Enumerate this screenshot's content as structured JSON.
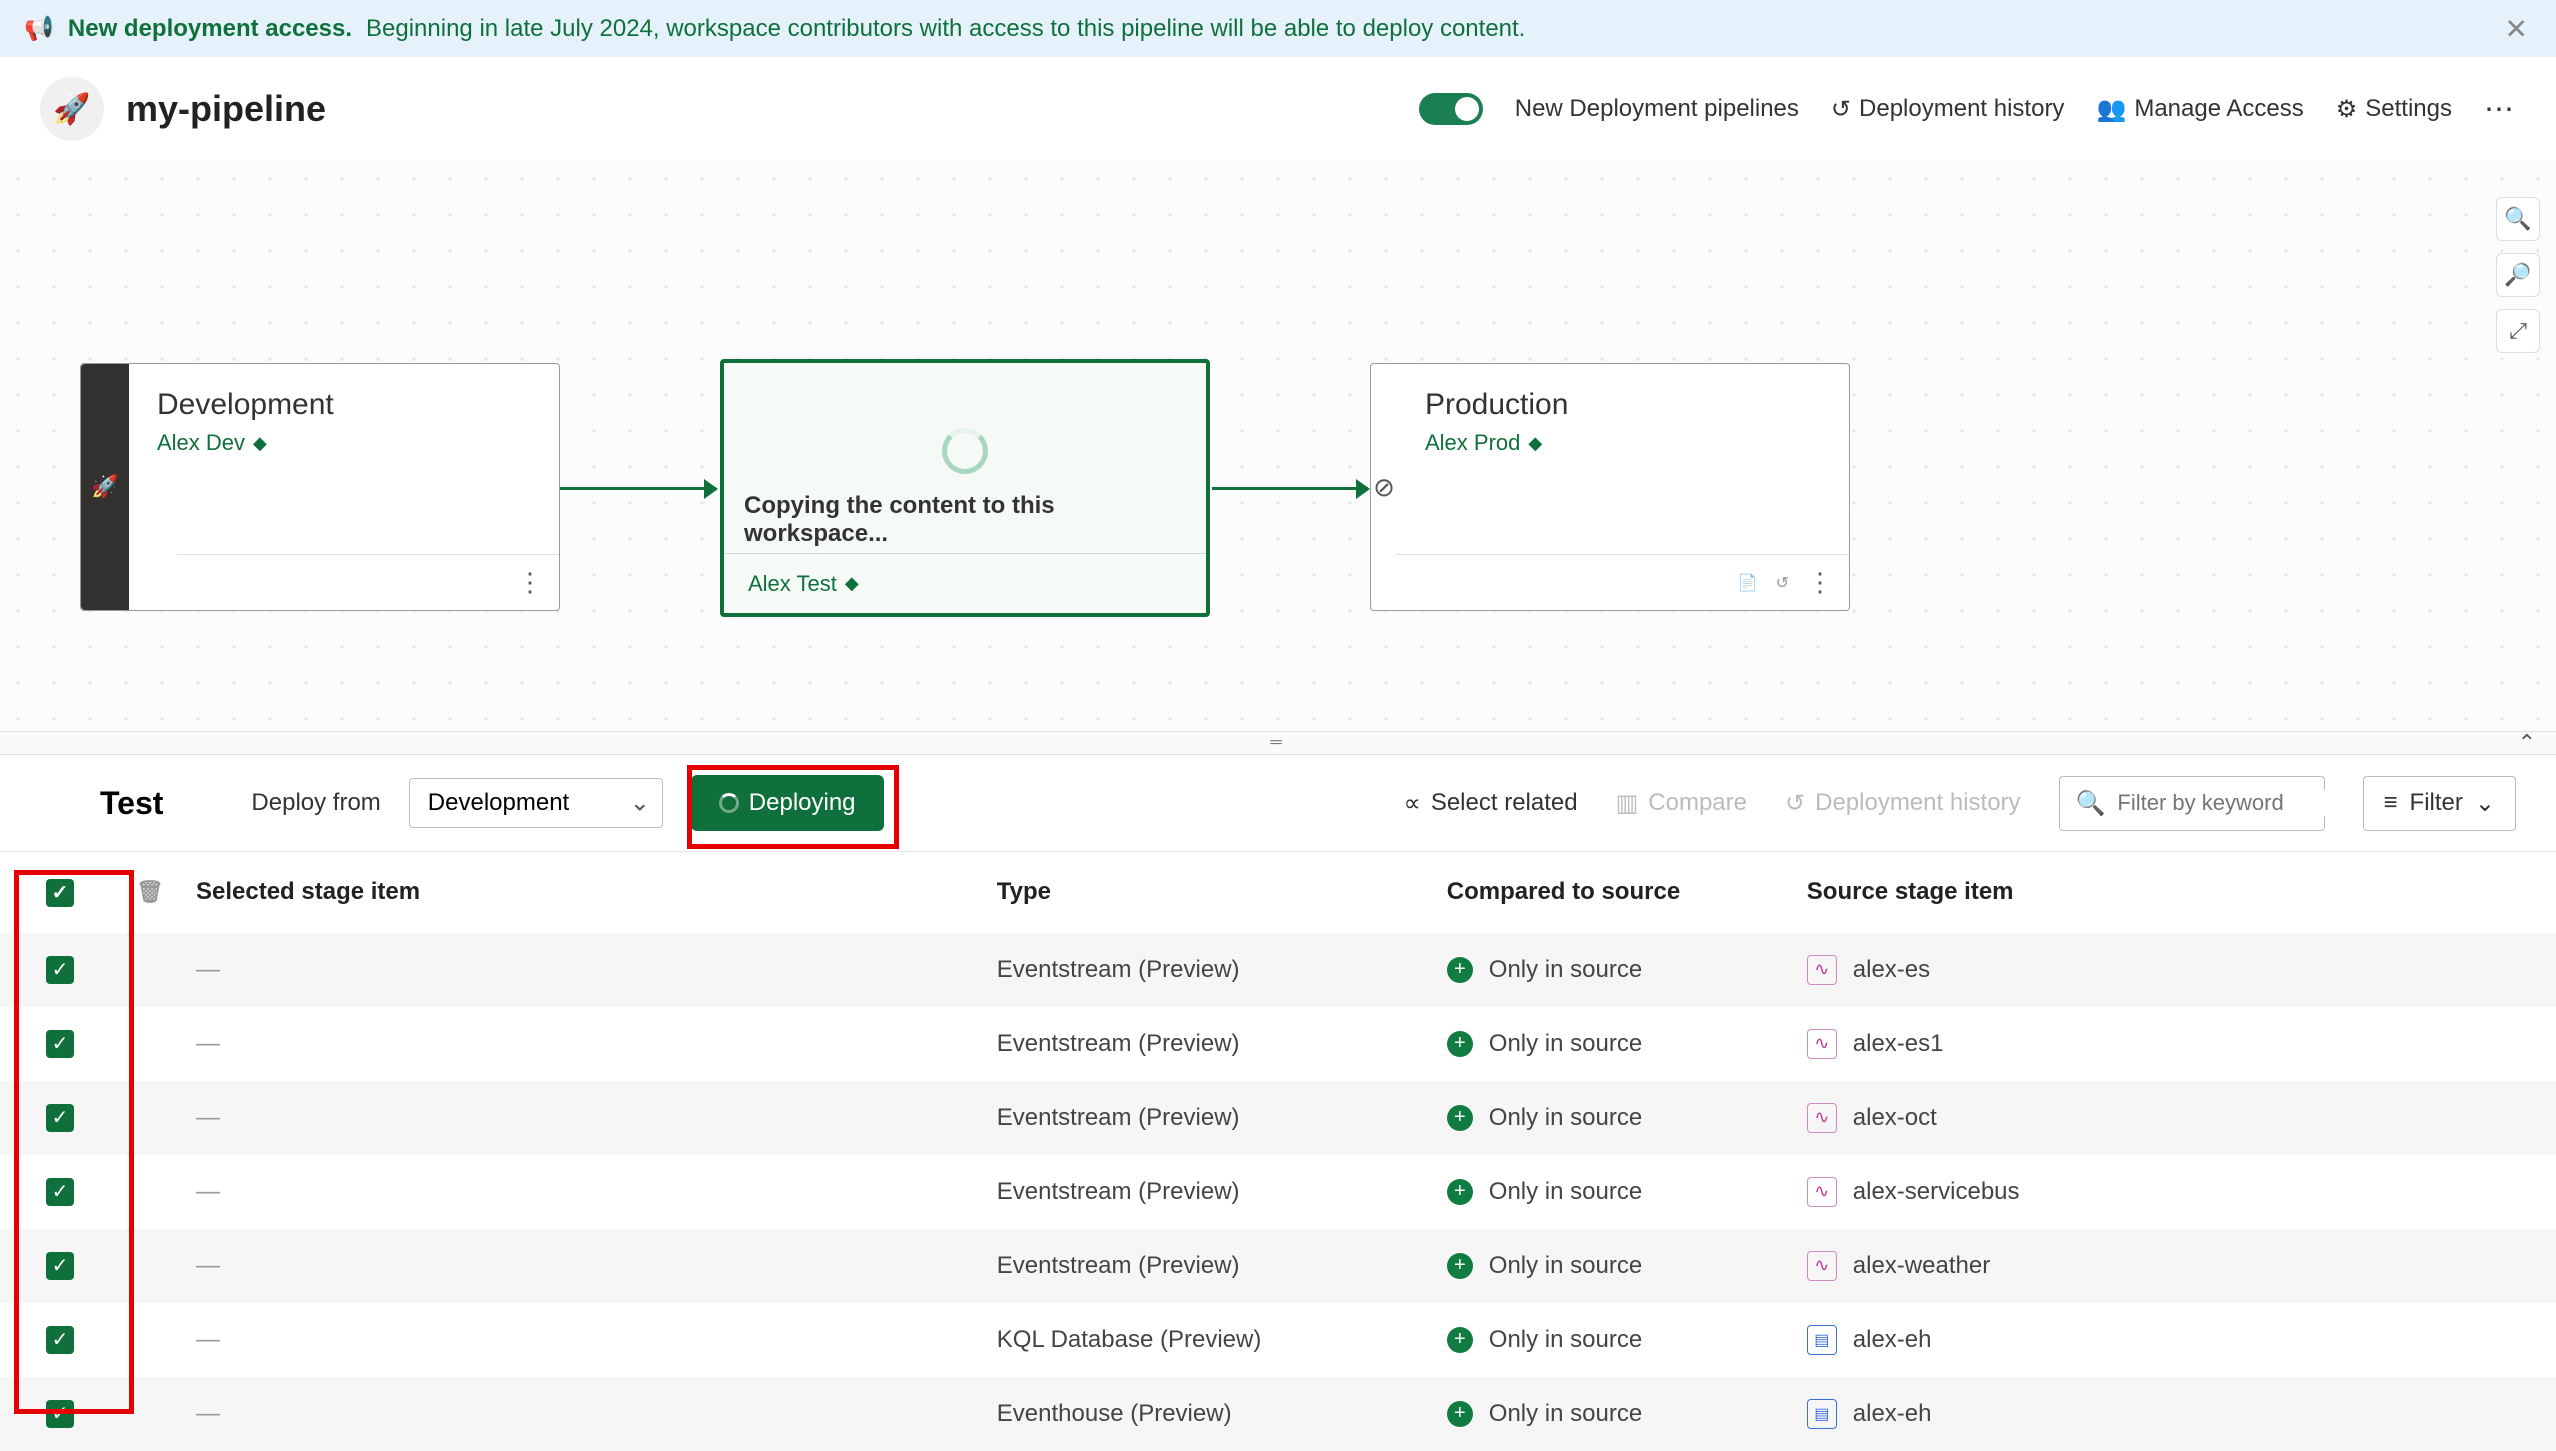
{
  "banner": {
    "title": "New deployment access.",
    "message": "Beginning in late July 2024, workspace contributors with access to this pipeline will be able to deploy content."
  },
  "header": {
    "pipeline_name": "my-pipeline",
    "toggle_label": "New Deployment pipelines",
    "history": "Deployment history",
    "manage_access": "Manage Access",
    "settings": "Settings"
  },
  "stages": {
    "dev": {
      "title": "Development",
      "workspace": "Alex Dev"
    },
    "test": {
      "copying": "Copying the content to this workspace...",
      "workspace": "Alex Test"
    },
    "prod": {
      "title": "Production",
      "workspace": "Alex Prod"
    }
  },
  "toolbar": {
    "title": "Test",
    "deploy_from_label": "Deploy from",
    "source_select": "Development",
    "deploying": "Deploying",
    "select_related": "Select related",
    "compare": "Compare",
    "deployment_history": "Deployment history",
    "filter_placeholder": "Filter by keyword",
    "filter_btn": "Filter"
  },
  "columns": {
    "selected": "Selected stage item",
    "type": "Type",
    "compared": "Compared to source",
    "source": "Source stage item"
  },
  "compare_status": "Only in source",
  "rows": [
    {
      "selected": "—",
      "type": "Eventstream (Preview)",
      "icon": "es",
      "source": "alex-es"
    },
    {
      "selected": "—",
      "type": "Eventstream (Preview)",
      "icon": "es",
      "source": "alex-es1"
    },
    {
      "selected": "—",
      "type": "Eventstream (Preview)",
      "icon": "es",
      "source": "alex-oct"
    },
    {
      "selected": "—",
      "type": "Eventstream (Preview)",
      "icon": "es",
      "source": "alex-servicebus"
    },
    {
      "selected": "—",
      "type": "Eventstream (Preview)",
      "icon": "es",
      "source": "alex-weather"
    },
    {
      "selected": "—",
      "type": "KQL Database (Preview)",
      "icon": "kql",
      "source": "alex-eh"
    },
    {
      "selected": "—",
      "type": "Eventhouse (Preview)",
      "icon": "kql",
      "source": "alex-eh"
    }
  ]
}
